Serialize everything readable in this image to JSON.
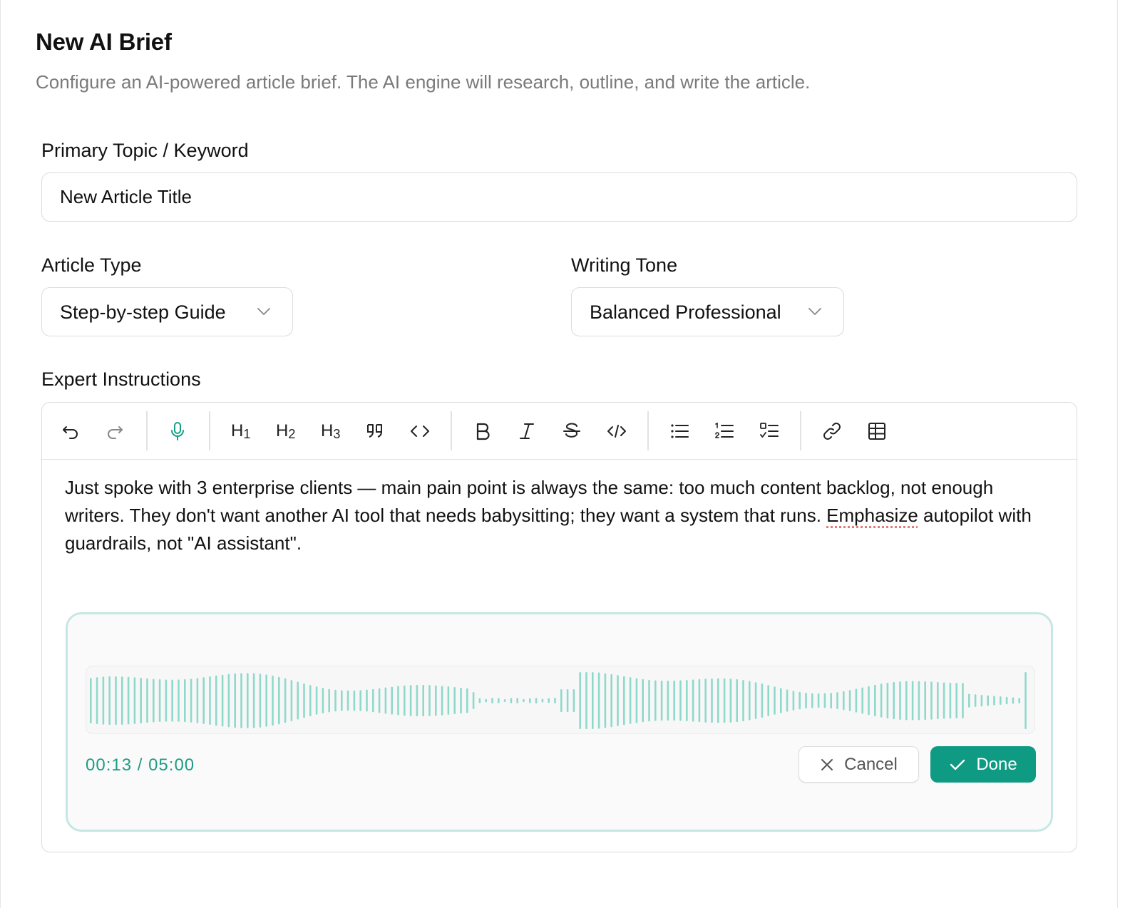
{
  "page": {
    "title": "New AI Brief",
    "subtitle": "Configure an AI-powered article brief. The AI engine will research, outline, and write the article."
  },
  "topic": {
    "label": "Primary Topic / Keyword",
    "value": "New Article Title"
  },
  "article_type": {
    "label": "Article Type",
    "selected": "Step-by-step Guide"
  },
  "writing_tone": {
    "label": "Writing Tone",
    "selected": "Balanced Professional"
  },
  "instructions": {
    "label": "Expert Instructions",
    "toolbar": {
      "h1": "H",
      "h1_sub": "1",
      "h2": "H",
      "h2_sub": "2",
      "h3": "H",
      "h3_sub": "3",
      "icons": [
        "undo-icon",
        "redo-icon",
        "microphone-icon",
        "heading-1",
        "heading-2",
        "heading-3",
        "quote-icon",
        "code-block-icon",
        "bold-icon",
        "italic-icon",
        "strikethrough-icon",
        "inline-code-icon",
        "bullet-list-icon",
        "ordered-list-icon",
        "task-list-icon",
        "link-icon",
        "table-icon"
      ]
    },
    "text_part1": "Just spoke with 3 enterprise clients — main pain point is always the same: too much content backlog, not enough writers. They don't want another AI tool that needs babysitting; they want a system that runs. ",
    "text_misspelled": "Emphasize",
    "text_part2": " autopilot with guardrails, not \"AI assistant\"."
  },
  "recorder": {
    "elapsed": "00:13",
    "separator": " / ",
    "limit": "05:00",
    "cancel_label": "Cancel",
    "done_label": "Done",
    "accent_color": "#0f9b83",
    "wave_color": "#8fd9cb"
  }
}
